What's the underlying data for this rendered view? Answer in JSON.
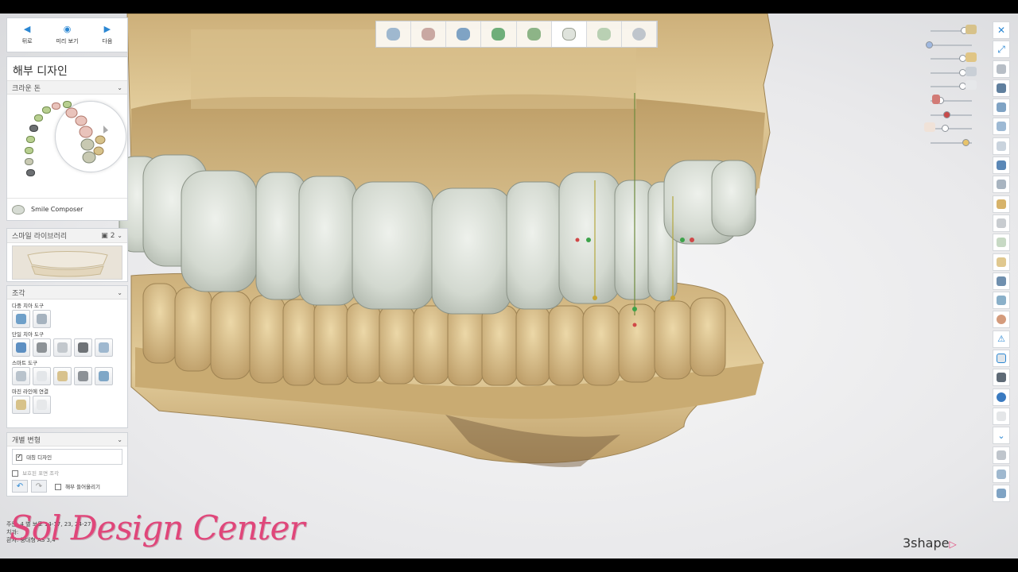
{
  "nav": {
    "back": "뒤로",
    "preview": "미리 보기",
    "next": "다음"
  },
  "page_title": "해부 디자인",
  "crown_section": "크라운 돈",
  "smile_composer": "Smile Composer",
  "smile_library": {
    "title": "스마일 라이브러리",
    "count": "2"
  },
  "sculpt": {
    "title": "조각",
    "multi_tooth": "다중 치아 도구",
    "single_tooth": "단일 치아 도구",
    "smart_tools": "스마트 도구",
    "margin_link": "마진 라인에 연결"
  },
  "individual": {
    "title": "개별 변형",
    "symmetric_design": "대칭 디자인",
    "protected_surface": "보호된 표면 조각",
    "adjacent": "해부 들어올리기"
  },
  "info": {
    "line1": "주문: 4 별 보토 14-17, 23, 24-27",
    "line2": "치과:",
    "line3": "환자: 중대형 AS 3,4"
  },
  "watermark": "Sol Design Center",
  "brand": "3shape",
  "colors": {
    "accent": "#2b87d3",
    "stone": "#d9c08e",
    "crown": "#d5dbd2",
    "watermark": "#e0467a"
  },
  "icons": {
    "back": "arrow-left-icon",
    "preview": "eye-icon",
    "next": "arrow-right-icon"
  }
}
